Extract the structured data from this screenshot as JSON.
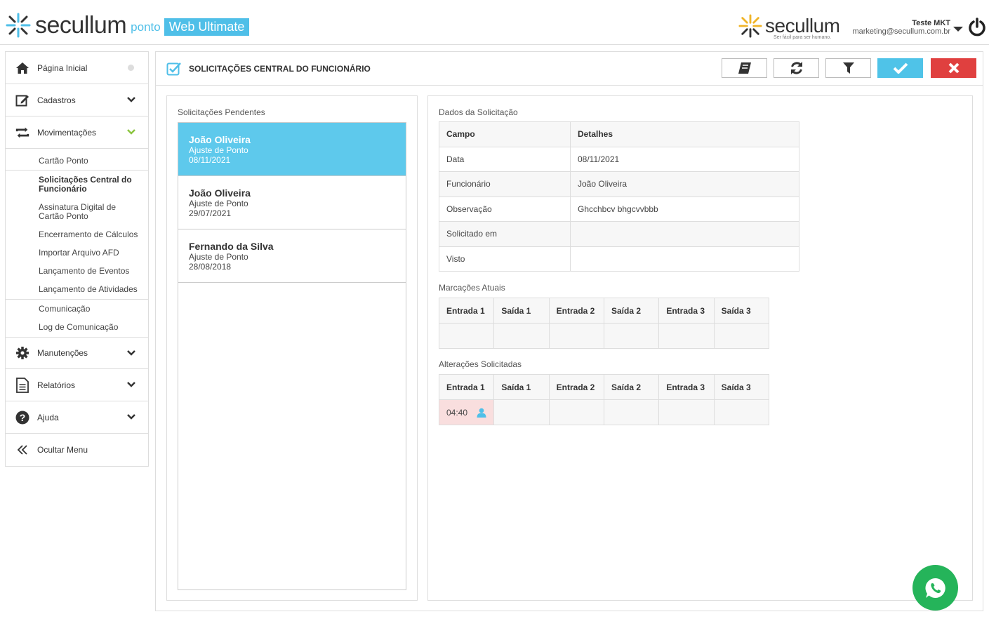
{
  "header": {
    "logo_word": "secullum",
    "logo_ponto": "ponto",
    "logo_edition": "Web Ultimate",
    "brand_word": "secullum",
    "brand_tagline": "Ser fácil para ser humano.",
    "user_name": "Teste MKT",
    "user_email": "marketing@secullum.com.br",
    "brand_color": "#4fbfe8"
  },
  "sidebar": {
    "items": [
      {
        "label": "Página Inicial",
        "icon": "home-icon"
      },
      {
        "label": "Cadastros",
        "icon": "edit-icon"
      },
      {
        "label": "Movimentações",
        "icon": "exchange-icon"
      }
    ],
    "sub_items": [
      {
        "label": "Cartão Ponto"
      },
      {
        "label": "Solicitações Central do Funcionário"
      },
      {
        "label": "Assinatura Digital de Cartão Ponto"
      },
      {
        "label": "Encerramento de Cálculos"
      },
      {
        "label": "Importar Arquivo AFD"
      },
      {
        "label": "Lançamento de Eventos"
      },
      {
        "label": "Lançamento de Atividades"
      },
      {
        "label": "Comunicação"
      },
      {
        "label": "Log de Comunicação"
      }
    ],
    "bottom_items": [
      {
        "label": "Manutenções",
        "icon": "gear-icon"
      },
      {
        "label": "Relatórios",
        "icon": "document-icon"
      },
      {
        "label": "Ajuda",
        "icon": "help-icon"
      },
      {
        "label": "Ocultar Menu",
        "icon": "double-chevron-left-icon"
      }
    ]
  },
  "main": {
    "title": "SOLICITAÇÕES CENTRAL DO FUNCIONÁRIO",
    "pending_label": "Solicitações Pendentes",
    "requests": [
      {
        "name": "João Oliveira",
        "type": "Ajuste de Ponto",
        "date": "08/11/2021",
        "selected": true
      },
      {
        "name": "João Oliveira",
        "type": "Ajuste de Ponto",
        "date": "29/07/2021",
        "selected": false
      },
      {
        "name": "Fernando da Silva",
        "type": "Ajuste de Ponto",
        "date": "28/08/2018",
        "selected": false
      }
    ],
    "details_label": "Dados da Solicitação",
    "details_headers": [
      "Campo",
      "Detalhes"
    ],
    "details_rows": [
      {
        "field": "Data",
        "value": "08/11/2021"
      },
      {
        "field": "Funcionário",
        "value": "João Oliveira"
      },
      {
        "field": "Observação",
        "value": "Ghcchbcv bhgcvvbbb"
      },
      {
        "field": "Solicitado em",
        "value": ""
      },
      {
        "field": "Visto",
        "value": ""
      }
    ],
    "current_label": "Marcações Atuais",
    "changes_label": "Alterações Solicitadas",
    "punch_headers": [
      "Entrada 1",
      "Saída 1",
      "Entrada 2",
      "Saída 2",
      "Entrada 3",
      "Saída 3"
    ],
    "requested_entrada1": "04:40"
  },
  "colors": {
    "selected_row": "#5ec9ec",
    "confirm": "#4fc3e8",
    "cancel": "#e0403f",
    "whatsapp": "#25b45a",
    "changed_cell": "#f9dede"
  }
}
